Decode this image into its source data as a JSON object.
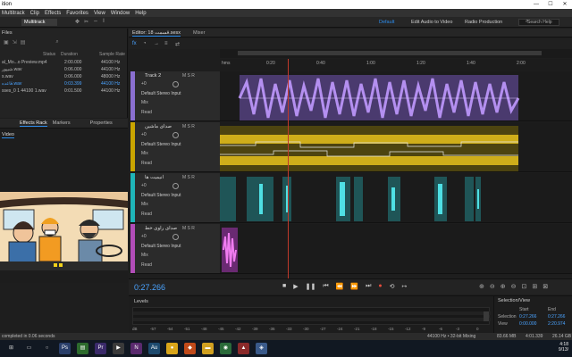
{
  "window": {
    "title": "ition",
    "minimize": "—",
    "maximize": "☐",
    "close": "✕"
  },
  "menu": [
    "Multitrack",
    "Clip",
    "Effects",
    "Favorites",
    "View",
    "Window",
    "Help"
  ],
  "toolbar": {
    "multitrack_label": "Multitrack",
    "workspaces": [
      "Default",
      "Edit Audio to Video",
      "Radio Production"
    ],
    "search_placeholder": "Search Help"
  },
  "files": {
    "title": "Files",
    "columns": [
      "Status",
      "Duration",
      "Sample Rate"
    ],
    "rows": [
      {
        "name": "al_Mo...o Preview.mp4",
        "duration": "2:00.000",
        "rate": "44100 Hz",
        "selected": false
      },
      {
        "name": "شیپور.wav",
        "duration": "0:06.000",
        "rate": "44100 Hz",
        "selected": false
      },
      {
        "name": "s.wav",
        "duration": "0:06.000",
        "rate": "48000 Hz",
        "selected": false
      },
      {
        "name": "قاعده.wav",
        "duration": "0:03.399",
        "rate": "44100 Hz",
        "selected": true
      },
      {
        "name": "sses_0 1 44100 1.wav",
        "duration": "0:01.500",
        "rate": "44100 Hz",
        "selected": false
      }
    ]
  },
  "panel_tabs": [
    "Effects Rack",
    "Markers",
    "Properties"
  ],
  "video_tab": "Video",
  "editor": {
    "tab_label": "Editor: 18 قسمت.sesx",
    "mixer_label": "Mixer",
    "ruler_unit": "hms",
    "ruler_ticks": [
      "0:20",
      "0:40",
      "1:00",
      "1:20",
      "1:40",
      "2:00"
    ]
  },
  "tracks": [
    {
      "name": "Track 2",
      "input": "Default Stereo Input",
      "mix": "Mix",
      "mode": "Read",
      "volume": "+0",
      "stripe": "#8a6fd0",
      "clip_color": "#9a72d8"
    },
    {
      "name": "صدای ماشین",
      "input": "Default Stereo Input",
      "mix": "Mix",
      "mode": "Read",
      "volume": "+0",
      "stripe": "#c9a400",
      "clip_color": "#d3b114"
    },
    {
      "name": "انیمیت ها",
      "input": "Default Stereo Input",
      "mix": "Mix",
      "mode": "Read",
      "volume": "+0",
      "stripe": "#1fb5b8",
      "clip_color": "#2ec4c8"
    },
    {
      "name": "صدای راوی خط",
      "input": "Default Stereo Input",
      "mix": "Mix",
      "mode": "Read",
      "volume": "+0",
      "stripe": "#b24db8",
      "clip_color": "#cc55cc"
    }
  ],
  "transport": {
    "timecode": "0:27.266"
  },
  "levels": {
    "title": "Levels",
    "scale": [
      "dB",
      "-57",
      "-54",
      "-51",
      "-48",
      "-45",
      "-42",
      "-39",
      "-36",
      "-33",
      "-30",
      "-27",
      "-24",
      "-21",
      "-18",
      "-15",
      "-12",
      "-9",
      "-6",
      "-3",
      "0"
    ]
  },
  "selection_view": {
    "title": "Selection/View",
    "start_label": "Start",
    "end_label": "End",
    "selection_label": "Selection",
    "view_label": "View",
    "selection_start": "0:27.266",
    "selection_end": "0:27.266",
    "view_start": "0:00.000",
    "view_end": "2:20.974"
  },
  "status": {
    "left": "completed in 0.06 seconds",
    "format": "44100 Hz • 32-bit Mixing",
    "size": "83.66 MB",
    "duration": "4:01.339",
    "free": "26.14 GB"
  },
  "taskbar": {
    "clock_time": "4:18",
    "clock_date": "9/13/"
  }
}
